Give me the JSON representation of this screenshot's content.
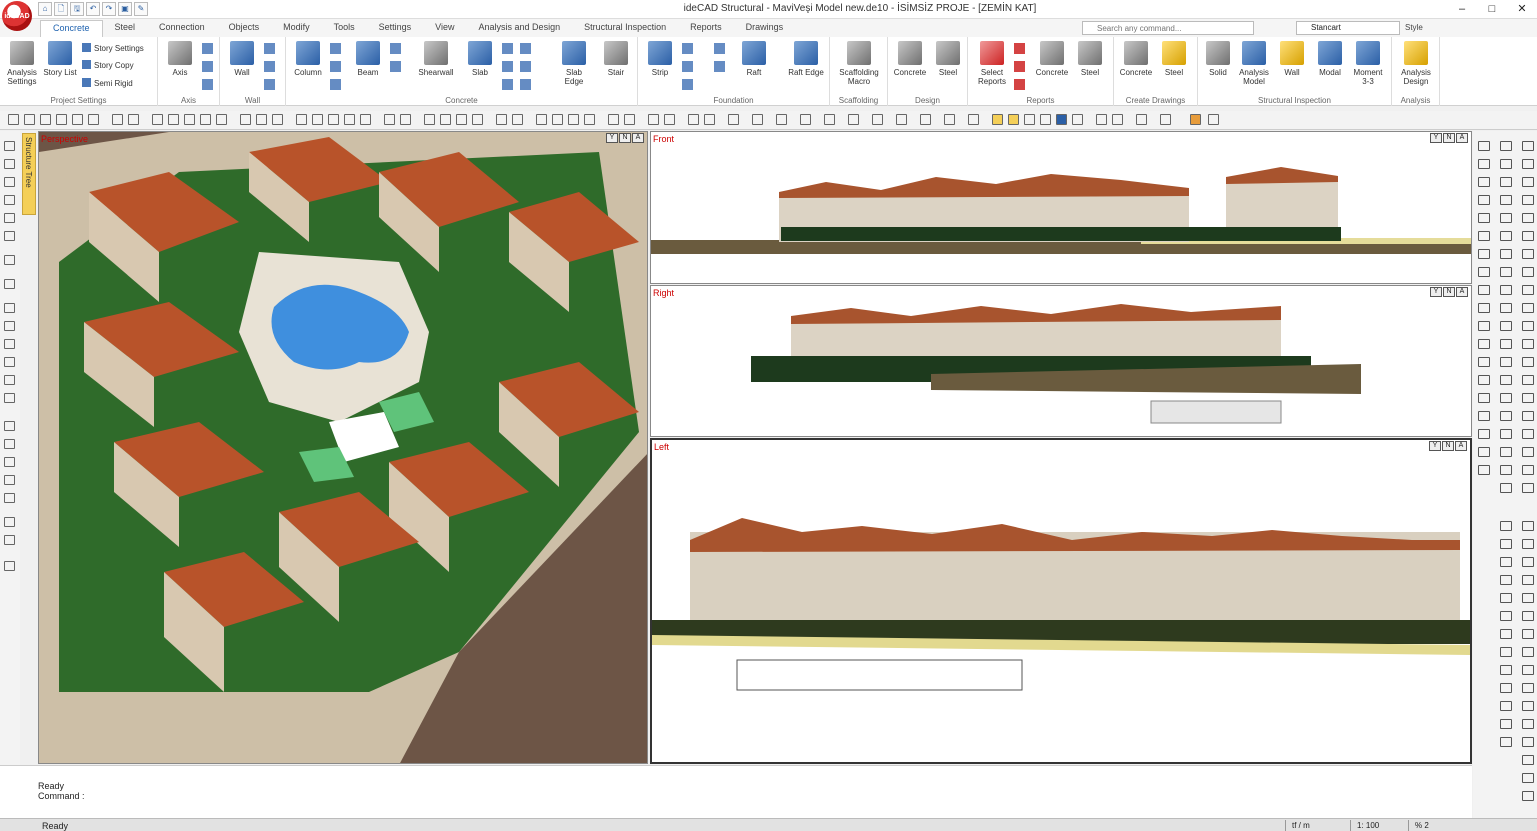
{
  "window": {
    "title": "ideCAD Structural - MaviVeşi Model new.de10 - İSİMSİZ PROJE - [ZEMİN KAT]",
    "logo": "ideCAD",
    "minimize": "–",
    "maximize": "□",
    "close": "✕"
  },
  "quick_access": [
    "⌂",
    "🗋",
    "🖫",
    "↶",
    "↷",
    "▣",
    "✎"
  ],
  "tabs": [
    "Concrete",
    "Steel",
    "Connection",
    "Objects",
    "Modify",
    "Tools",
    "Settings",
    "View",
    "Analysis and Design",
    "Structural Inspection",
    "Reports",
    "Drawings"
  ],
  "search": {
    "placeholder": "Search any command..."
  },
  "style": {
    "selected": "Stancart",
    "label": "Style"
  },
  "ribbon": {
    "project": {
      "group": "Project Settings",
      "analysis": "Analysis Settings",
      "story": "Story List",
      "story_settings": "Story Settings",
      "story_copy": "Story Copy",
      "semi_rigid": "Semi Rigid"
    },
    "axis": {
      "group": "Axis",
      "axis": "Axis"
    },
    "wall": {
      "group": "Wall",
      "wall": "Wall"
    },
    "concrete": {
      "group": "Concrete",
      "column": "Column",
      "beam": "Beam",
      "shearwall": "Shearwall",
      "slab": "Slab",
      "slab_edge": "Slab Edge",
      "stair": "Stair"
    },
    "foundation": {
      "group": "Foundation",
      "strip": "Strip",
      "raft": "Raft",
      "raft_edge": "Raft Edge"
    },
    "scaffolding": {
      "group": "Scaffolding",
      "macro": "Scaffolding Macro"
    },
    "design": {
      "group": "Design",
      "concrete": "Concrete",
      "steel": "Steel"
    },
    "reports": {
      "group": "Reports",
      "select": "Select Reports",
      "concrete": "Concrete",
      "steel": "Steel"
    },
    "drawings": {
      "group": "Create Drawings",
      "concrete": "Concrete",
      "steel": "Steel"
    },
    "inspection": {
      "group": "Structural Inspection",
      "solid": "Solid",
      "analysis_model": "Analysis Model",
      "wall": "Wall",
      "modal": "Modal",
      "moment": "Moment 3-3"
    },
    "analysis": {
      "group": "Analysis",
      "design": "Analysis Design"
    }
  },
  "sidebar": {
    "structure_tree": "Structure Tree"
  },
  "viewports": {
    "perspective": "Perspective",
    "front": "Front",
    "right": "Right",
    "left": "Left",
    "controls": [
      "Y",
      "N",
      "A"
    ]
  },
  "command": {
    "line1": "Ready",
    "line2": "Command :"
  },
  "status": {
    "left": "Ready",
    "unit": "tf / m",
    "scale": "1: 100",
    "zoom": "% 2"
  },
  "colors": {
    "roof": "#b8532a",
    "grass": "#2f6b2a",
    "pool": "#3f8fde",
    "ground": "#6d5546",
    "paving": "#cdbfa7",
    "accent": "#1f63b0"
  }
}
